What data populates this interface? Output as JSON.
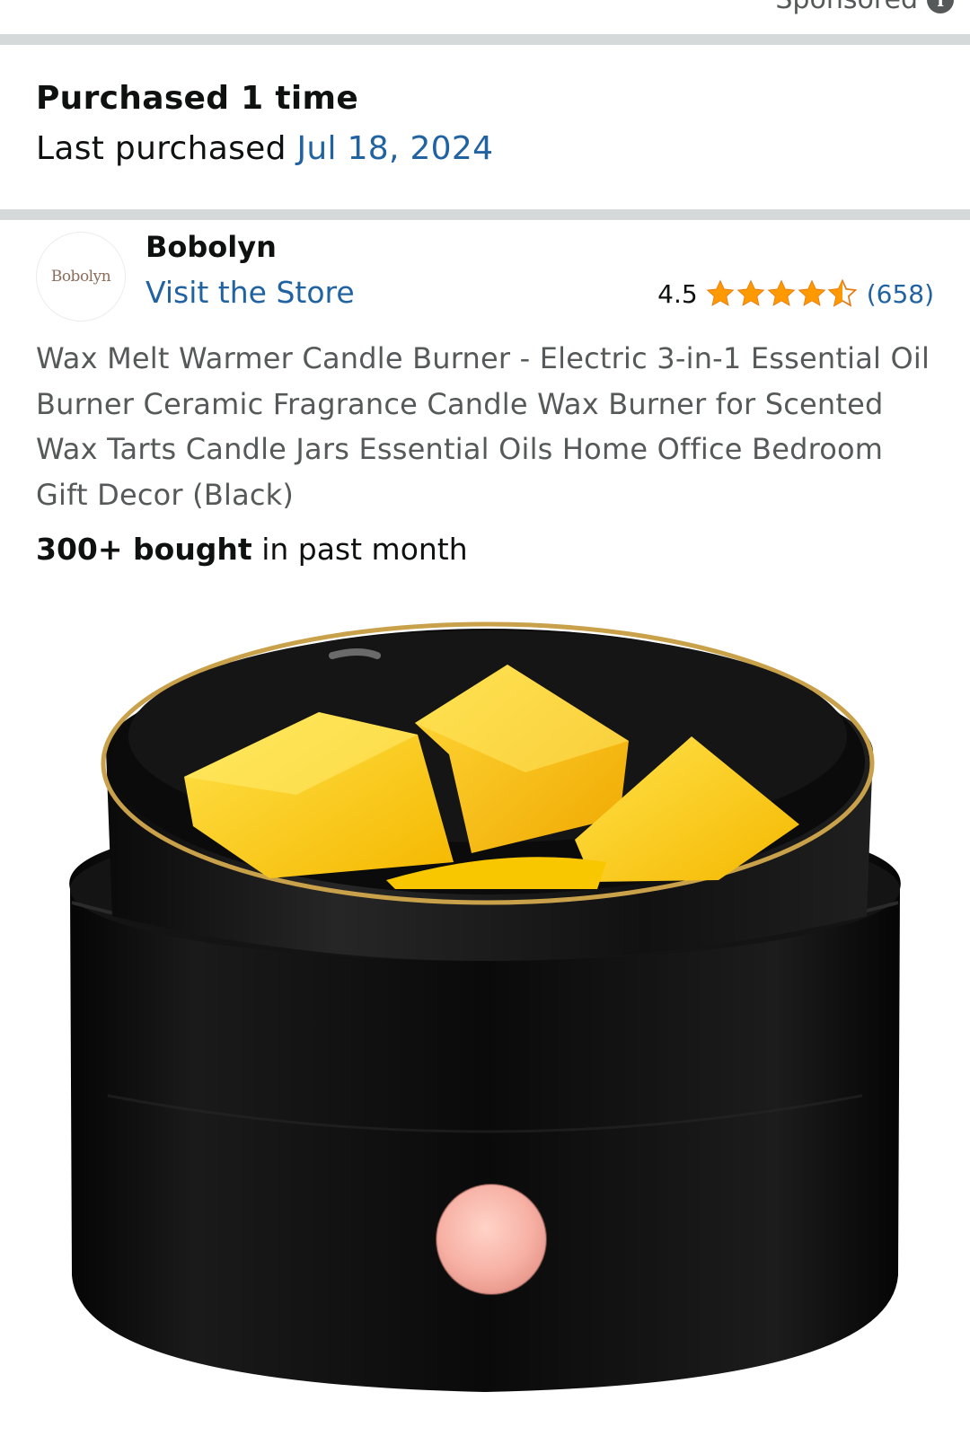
{
  "header": {
    "sponsored_label": "Sponsored",
    "info_icon": "info-icon"
  },
  "purchase_history": {
    "count_label": "Purchased 1 time",
    "last_label": "Last purchased",
    "last_date": "Jul 18, 2024"
  },
  "brand": {
    "logo_text": "Bobolyn",
    "name": "Bobolyn",
    "store_link": "Visit the Store"
  },
  "rating": {
    "value": "4.5",
    "stars": 4.5,
    "count": "(658)",
    "star_color": "#ff9900"
  },
  "product": {
    "title": "Wax Melt Warmer Candle Burner - Electric 3-in-1 Essential Oil Burner Ceramic Fragrance Candle Wax Burner for Scented Wax Tarts Candle Jars Essential Oils Home Office Bedroom Gift Decor (Black)",
    "bought_bold": "300+ bought",
    "bought_rest": " in past month"
  },
  "colors": {
    "link": "#2162a1",
    "divider": "#d5d9d9",
    "muted_text": "#565959"
  }
}
